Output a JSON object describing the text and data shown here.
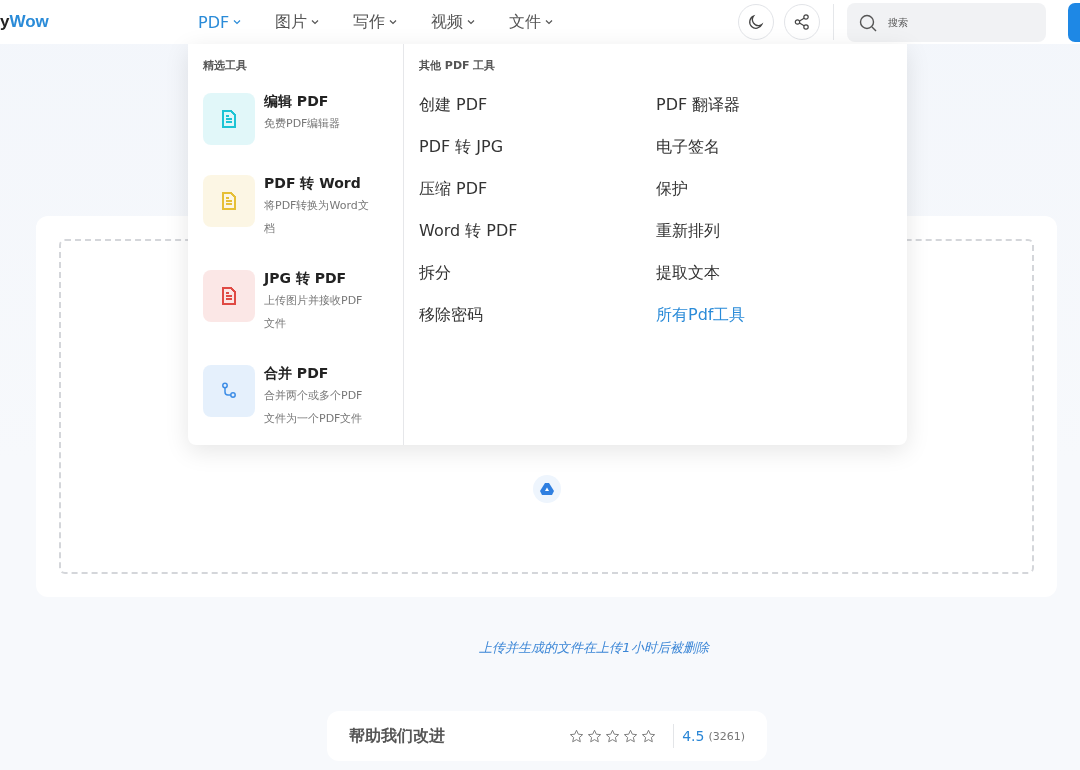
{
  "header": {
    "logo": {
      "lead": "y",
      "accent": "Wow"
    },
    "nav": [
      {
        "label": "PDF",
        "selected": true
      },
      {
        "label": "图片",
        "selected": false
      },
      {
        "label": "写作",
        "selected": false
      },
      {
        "label": "视频",
        "selected": false
      },
      {
        "label": "文件",
        "selected": false
      }
    ],
    "search": {
      "placeholder": "搜索"
    }
  },
  "dropdown": {
    "featured_title": "精选工具",
    "featured": [
      {
        "title": "编辑 PDF",
        "description": "免费PDF编辑器",
        "kind": "document",
        "color": "#1cc4d4"
      },
      {
        "title": "PDF 转 Word",
        "description": "将PDF转换为Word文档",
        "kind": "document",
        "color": "#e6bf36"
      },
      {
        "title": "JPG 转 PDF",
        "description": "上传图片并接收PDF文件",
        "kind": "document",
        "color": "#e04a44"
      },
      {
        "title": "合并 PDF",
        "description": "合并两个或多个PDF文件为一个PDF文件",
        "kind": "merge",
        "color": "#3d8de6"
      }
    ],
    "other_title": "其他 PDF 工具",
    "other": [
      {
        "label": "创建 PDF",
        "kind": "tool"
      },
      {
        "label": "PDF 翻译器",
        "kind": "tool"
      },
      {
        "label": "PDF 转 JPG",
        "kind": "tool"
      },
      {
        "label": "电子签名",
        "kind": "tool"
      },
      {
        "label": "压缩 PDF",
        "kind": "tool"
      },
      {
        "label": "保护",
        "kind": "tool"
      },
      {
        "label": "Word 转 PDF",
        "kind": "tool"
      },
      {
        "label": "重新排列",
        "kind": "tool"
      },
      {
        "label": "拆分",
        "kind": "tool"
      },
      {
        "label": "提取文本",
        "kind": "tool"
      },
      {
        "label": "移除密码",
        "kind": "tool"
      },
      {
        "label": "所有Pdf工具",
        "kind": "link"
      }
    ]
  },
  "upload_note": "上传并生成的文件在上传1小时后被删除",
  "rating": {
    "prompt": "帮助我们改进",
    "stars": 0,
    "score": "4.5",
    "count": "(3261)"
  }
}
